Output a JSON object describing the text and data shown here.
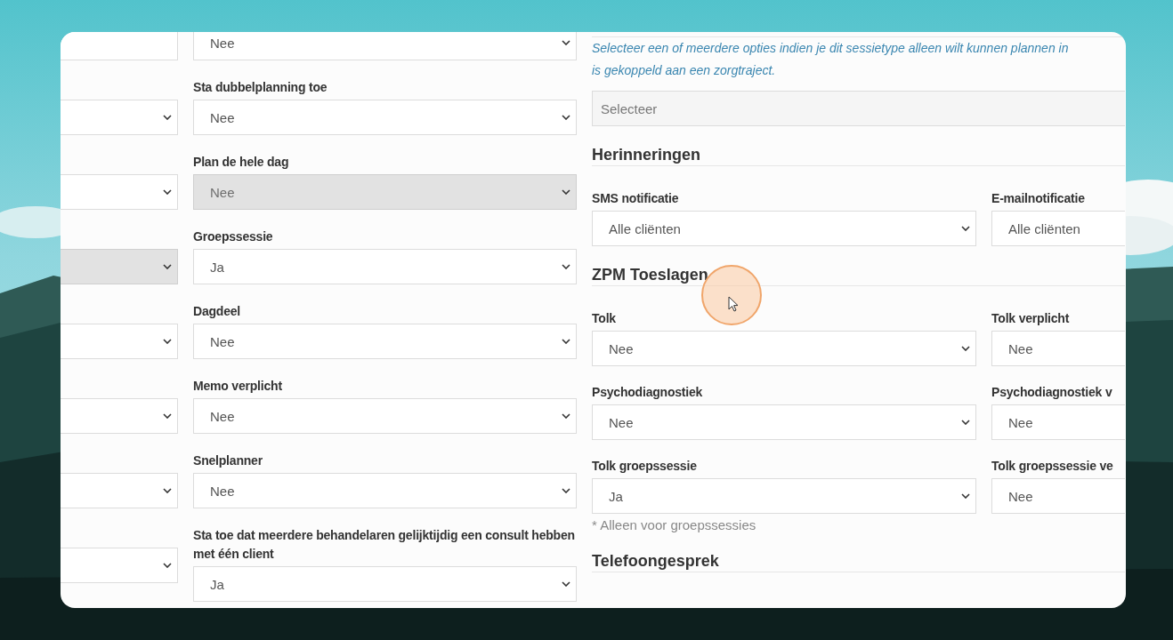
{
  "left_column": {
    "fields": [
      {
        "kind": "text",
        "disabled": false
      },
      {
        "kind": "select",
        "disabled": false
      },
      {
        "kind": "select",
        "disabled": false
      },
      {
        "kind": "select",
        "disabled": true
      },
      {
        "kind": "select",
        "disabled": false
      },
      {
        "kind": "select",
        "disabled": false
      },
      {
        "kind": "select",
        "disabled": false
      },
      {
        "kind": "select",
        "disabled": false
      }
    ]
  },
  "middle_column": {
    "fields": [
      {
        "value": "Nee",
        "disabled": false
      },
      {
        "label": "Sta dubbelplanning toe",
        "value": "Nee",
        "disabled": false
      },
      {
        "label": "Plan de hele dag",
        "value": "Nee",
        "disabled": true
      },
      {
        "label": "Groepssessie",
        "value": "Ja",
        "disabled": false
      },
      {
        "label": "Dagdeel",
        "value": "Nee",
        "disabled": false
      },
      {
        "label": "Memo verplicht",
        "value": "Nee",
        "disabled": false
      },
      {
        "label": "Snelplanner",
        "value": "Nee",
        "disabled": false
      },
      {
        "label": "Sta toe dat meerdere behandelaren gelijktijdig een consult hebben met één client",
        "value": "Ja",
        "disabled": false
      }
    ]
  },
  "right_panel": {
    "sections": [
      {
        "hint_lines": [
          "Selecteer een of meerdere opties indien je dit sessietype alleen wilt kunnen plannen in",
          "is gekoppeld aan een zorgtraject."
        ],
        "select": {
          "placeholder": "Selecteer"
        }
      },
      {
        "heading": "Herinneringen",
        "rows": [
          [
            {
              "label": "SMS notificatie",
              "value": "Alle cliënten"
            },
            {
              "label": "E-mailnotificatie",
              "value": "Alle cliënten"
            }
          ]
        ]
      },
      {
        "heading": "ZPM Toeslagen",
        "rows": [
          [
            {
              "label": "Tolk",
              "value": "Nee"
            },
            {
              "label": "Tolk verplicht",
              "value": "Nee"
            }
          ],
          [
            {
              "label": "Psychodiagnostiek",
              "value": "Nee"
            },
            {
              "label": "Psychodiagnostiek v",
              "value": "Nee"
            }
          ],
          [
            {
              "label": "Tolk groepssessie",
              "value": "Ja"
            },
            {
              "label": "Tolk groepssessie ve",
              "value": "Nee"
            }
          ]
        ],
        "note": "* Alleen voor groepssessies"
      },
      {
        "heading": "Telefoongesprek"
      }
    ]
  }
}
